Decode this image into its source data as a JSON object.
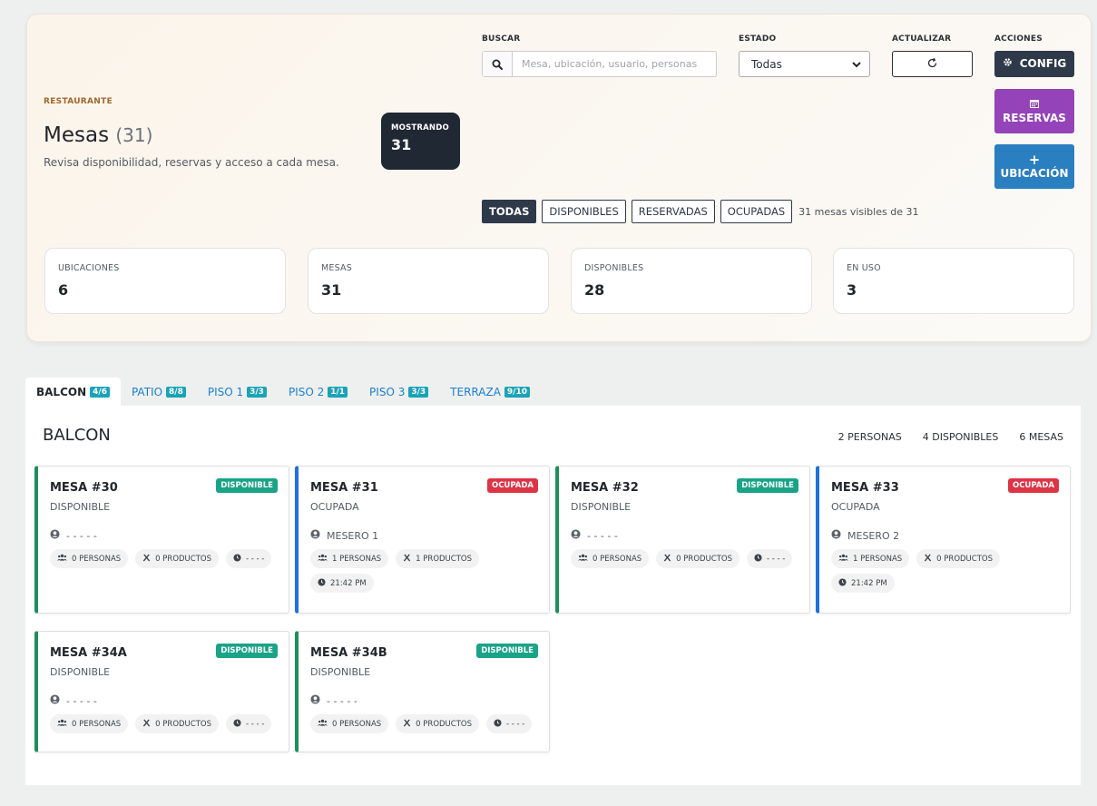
{
  "header": {
    "eyebrow": "RESTAURANTE",
    "title": "Mesas",
    "count": "(31)",
    "subtitle": "Revisa disponibilidad, reservas y acceso a cada mesa.",
    "showing_label": "MOSTRANDO",
    "showing_value": "31"
  },
  "search": {
    "label": "BUSCAR",
    "placeholder": "Mesa, ubicación, usuario, personas",
    "value": ""
  },
  "state": {
    "label": "ESTADO",
    "selected": "Todas"
  },
  "refresh": {
    "label": "ACTUALIZAR"
  },
  "actions": {
    "label": "ACCIONES",
    "config": "CONFIG",
    "reservas": "RESERVAS",
    "ubicacion": "UBICACIÓN"
  },
  "filters": {
    "chips": [
      "TODAS",
      "DISPONIBLES",
      "RESERVADAS",
      "OCUPADAS"
    ],
    "active": "TODAS",
    "info": "31 mesas visibles de 31"
  },
  "stats": [
    {
      "label": "UBICACIONES",
      "value": "6"
    },
    {
      "label": "MESAS",
      "value": "31"
    },
    {
      "label": "DISPONIBLES",
      "value": "28"
    },
    {
      "label": "EN USO",
      "value": "3"
    }
  ],
  "tabs": [
    {
      "label": "BALCON",
      "badge": "4/6"
    },
    {
      "label": "PATIO",
      "badge": "8/8"
    },
    {
      "label": "PISO 1",
      "badge": "3/3"
    },
    {
      "label": "PISO 2",
      "badge": "1/1"
    },
    {
      "label": "PISO 3",
      "badge": "3/3"
    },
    {
      "label": "TERRAZA",
      "badge": "9/10"
    }
  ],
  "panel": {
    "title": "BALCON",
    "personas": "2 PERSONAS",
    "disponibles": "4 DISPONIBLES",
    "mesas": "6 MESAS"
  },
  "tables": [
    {
      "name": "MESA #30",
      "status_text": "DISPONIBLE",
      "badge": "DISPONIBLE",
      "waiter": "- - - - -",
      "personas": "0 PERSONAS",
      "productos": "0 PRODUCTOS",
      "time": "- - - -"
    },
    {
      "name": "MESA #31",
      "status_text": "OCUPADA",
      "badge": "OCUPADA",
      "waiter": "MESERO 1",
      "personas": "1 PERSONAS",
      "productos": "1 PRODUCTOS",
      "time": "21:42 PM"
    },
    {
      "name": "MESA #32",
      "status_text": "DISPONIBLE",
      "badge": "DISPONIBLE",
      "waiter": "- - - - -",
      "personas": "0 PERSONAS",
      "productos": "0 PRODUCTOS",
      "time": "- - - -"
    },
    {
      "name": "MESA #33",
      "status_text": "OCUPADA",
      "badge": "OCUPADA",
      "waiter": "MESERO 2",
      "personas": "1 PERSONAS",
      "productos": "0 PRODUCTOS",
      "time": "21:42 PM"
    },
    {
      "name": "MESA #34A",
      "status_text": "DISPONIBLE",
      "badge": "DISPONIBLE",
      "waiter": "- - - - -",
      "personas": "0 PERSONAS",
      "productos": "0 PRODUCTOS",
      "time": "- - - -"
    },
    {
      "name": "MESA #34B",
      "status_text": "DISPONIBLE",
      "badge": "DISPONIBLE",
      "waiter": "- - - - -",
      "personas": "0 PERSONAS",
      "productos": "0 PRODUCTOS",
      "time": "- - - -"
    }
  ],
  "colors": {
    "available": "#1aa387",
    "occupied": "#dc3545",
    "accent_dark": "#2e3a4a",
    "reservas": "#9443b8",
    "ubicacion": "#2a7fc0"
  }
}
